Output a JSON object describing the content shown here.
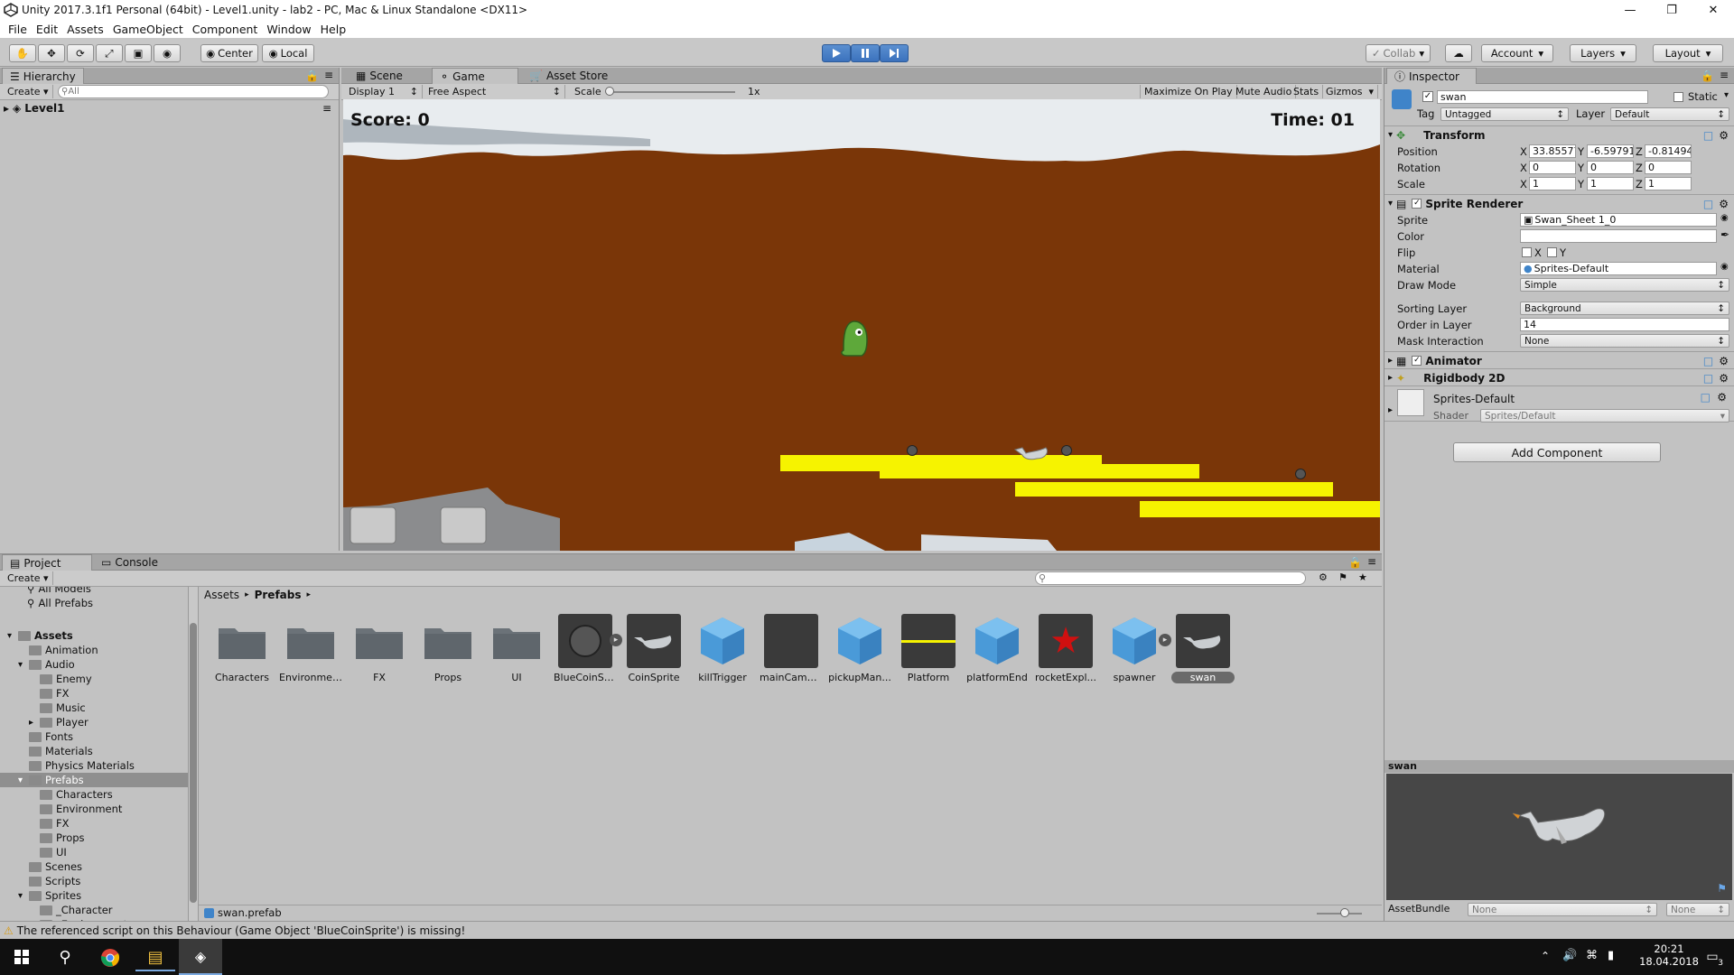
{
  "window": {
    "title": "Unity 2017.3.1f1 Personal (64bit) - Level1.unity - lab2 - PC, Mac & Linux Standalone <DX11>"
  },
  "menu": [
    "File",
    "Edit",
    "Assets",
    "GameObject",
    "Component",
    "Window",
    "Help"
  ],
  "toolbar": {
    "center": "Center",
    "local": "Local",
    "collab": "Collab",
    "account": "Account",
    "layers": "Layers",
    "layout": "Layout"
  },
  "hierarchy": {
    "tab": "Hierarchy",
    "create": "Create",
    "search_placeholder": "All",
    "scene": "Level1"
  },
  "views": {
    "tabs": [
      "Scene",
      "Game",
      "Asset Store"
    ],
    "display": "Display 1",
    "aspect": "Free Aspect",
    "scale_label": "Scale",
    "scale_value": "1x",
    "buttons": [
      "Maximize On Play",
      "Mute Audio",
      "Stats",
      "Gizmos"
    ]
  },
  "game": {
    "score": "Score: 0",
    "time": "Time: 01"
  },
  "inspector": {
    "tab": "Inspector",
    "name": "swan",
    "static": "Static",
    "tag_label": "Tag",
    "tag": "Untagged",
    "layer_label": "Layer",
    "layer": "Default",
    "transform": {
      "title": "Transform",
      "position_label": "Position",
      "position": [
        "33.85577",
        "-6.597912",
        "-0.814941"
      ],
      "rotation_label": "Rotation",
      "rotation": [
        "0",
        "0",
        "0"
      ],
      "scale_label": "Scale",
      "scale": [
        "1",
        "1",
        "1"
      ],
      "axes": [
        "X",
        "Y",
        "Z"
      ]
    },
    "sprite_renderer": {
      "title": "Sprite Renderer",
      "sprite_label": "Sprite",
      "sprite": "Swan_Sheet 1_0",
      "color_label": "Color",
      "flip_label": "Flip",
      "flip_x": "X",
      "flip_y": "Y",
      "material_label": "Material",
      "material": "Sprites-Default",
      "draw_mode_label": "Draw Mode",
      "draw_mode": "Simple",
      "sorting_layer_label": "Sorting Layer",
      "sorting_layer": "Background",
      "order_label": "Order in Layer",
      "order": "14",
      "mask_label": "Mask Interaction",
      "mask": "None"
    },
    "animator": "Animator",
    "rigidbody": "Rigidbody 2D",
    "material_block": {
      "name": "Sprites-Default",
      "shader_label": "Shader",
      "shader": "Sprites/Default"
    },
    "add_component": "Add Component",
    "preview_title": "swan",
    "assetbundle_label": "AssetBundle",
    "assetbundle": "None",
    "assetbundle_variant": "None"
  },
  "project": {
    "tabs": [
      "Project",
      "Console"
    ],
    "create": "Create",
    "favorites": [
      "All Models",
      "All Prefabs"
    ],
    "tree": [
      {
        "label": "Assets",
        "depth": 0
      },
      {
        "label": "Animation",
        "depth": 1
      },
      {
        "label": "Audio",
        "depth": 1
      },
      {
        "label": "Enemy",
        "depth": 2
      },
      {
        "label": "FX",
        "depth": 2
      },
      {
        "label": "Music",
        "depth": 2
      },
      {
        "label": "Player",
        "depth": 2
      },
      {
        "label": "Fonts",
        "depth": 1
      },
      {
        "label": "Materials",
        "depth": 1
      },
      {
        "label": "Physics Materials",
        "depth": 1
      },
      {
        "label": "Prefabs",
        "depth": 1
      },
      {
        "label": "Characters",
        "depth": 2
      },
      {
        "label": "Environment",
        "depth": 2
      },
      {
        "label": "FX",
        "depth": 2
      },
      {
        "label": "Props",
        "depth": 2
      },
      {
        "label": "UI",
        "depth": 2
      },
      {
        "label": "Scenes",
        "depth": 1
      },
      {
        "label": "Scripts",
        "depth": 1
      },
      {
        "label": "Sprites",
        "depth": 1
      },
      {
        "label": "_Character",
        "depth": 2
      },
      {
        "label": "_Environment",
        "depth": 2
      }
    ],
    "breadcrumb": [
      "Assets",
      "Prefabs"
    ],
    "assets": [
      "Characters",
      "Environment",
      "FX",
      "Props",
      "UI",
      "BlueCoinSp...",
      "CoinSprite",
      "killTrigger",
      "mainCamera",
      "pickupMan...",
      "Platform",
      "platformEnd",
      "rocketExpl...",
      "spawner",
      "swan"
    ],
    "selected_file": "swan.prefab"
  },
  "status": "The referenced script on this Behaviour (Game Object 'BlueCoinSprite') is missing!",
  "clock": {
    "time": "20:21",
    "date": "18.04.2018"
  },
  "notifications": "3"
}
